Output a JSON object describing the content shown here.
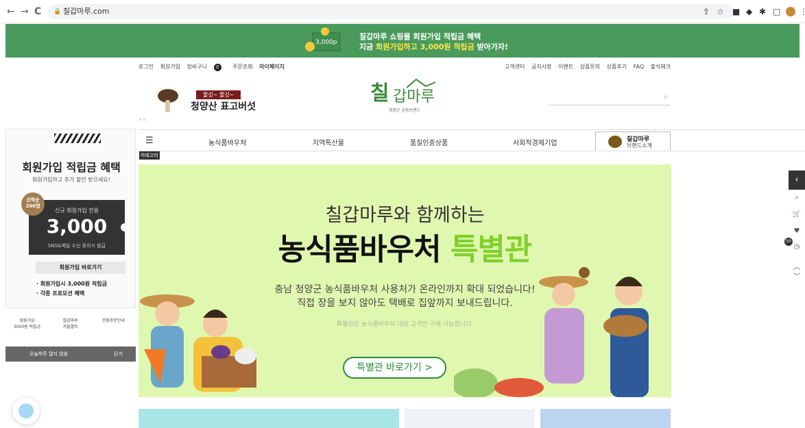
{
  "browser": {
    "url": "칠갑마루.com",
    "back": "←",
    "forward": "→",
    "reload": "C"
  },
  "top_banner": {
    "coin_label": "3,000p",
    "line1": "칠갑마루 쇼핑몰 회원가입 적립금 혜택",
    "line2_pre": "지금 ",
    "line2_hl": "회원가입하고 3,000원 적립금",
    "line2_post": " 받아가자!"
  },
  "util_left": {
    "login": "로그인",
    "join": "회원가입",
    "cart": "장바구니",
    "cart_count": "0",
    "order": "주문조회",
    "mypage": "마이페이지"
  },
  "util_right": [
    "고객센터",
    "공지사항",
    "이벤트",
    "상품문의",
    "상품후기",
    "FAQ",
    "출석체크"
  ],
  "promo": {
    "small": "쫄깃~ 쫄깃~",
    "large": "청양산 표고버섯",
    "arrows": "‹ ›"
  },
  "logo": {
    "text": "칠갑마루",
    "sub": "청양군 공동브랜드"
  },
  "gnb": {
    "items": [
      "농식품바우처",
      "지역특산물",
      "품질인증상품",
      "사회적경제기업"
    ],
    "brand_title": "칠갑마루",
    "brand_sub": "브랜드소개",
    "category_label": "카테고리"
  },
  "left_panel": {
    "title": "회원가입 적립금 혜택",
    "sub": "회원가입하고 추가 할인 받으세요!",
    "circle": "선착순\n200명",
    "coupon_label": "신규 회원가입 전용",
    "coupon_value": "3,000",
    "coupon_note": "SNS&메일 수신 동의시 발급",
    "button": "회원가입 바로가기",
    "bullet1": "· 회원가입시 3,000원 적립금",
    "bullet2": "· 각종 프로모션 혜택",
    "links": [
      "회원가입\n3000원 적립금",
      "칠갑마루\n겨울별미",
      "전화주문안내"
    ],
    "close_today": "오늘하루 열지 않음",
    "close": "닫기"
  },
  "hero": {
    "line1": "칠갑마루와 함께하는",
    "line2_black": "농식품바우처 ",
    "line2_green": "특별관",
    "p1": "충남 청양군 농식품바우처 사용처가 온라인까지 확대 되었습니다!",
    "p2": "직접 장을 보지 않아도 택배로 집앞까지 보내드립니다.",
    "p3": "특별관은 농식품바우처 대상 고객만 구매 가능합니다.",
    "cta": "특별관 바로가기 >"
  },
  "right_bar": {
    "badge": "50"
  },
  "colors": {
    "banner_green": "#4a9a5c",
    "hero_bg": "#e0f7b0",
    "accent_green": "#7fd12a",
    "cta_green": "#2d8a3a"
  }
}
